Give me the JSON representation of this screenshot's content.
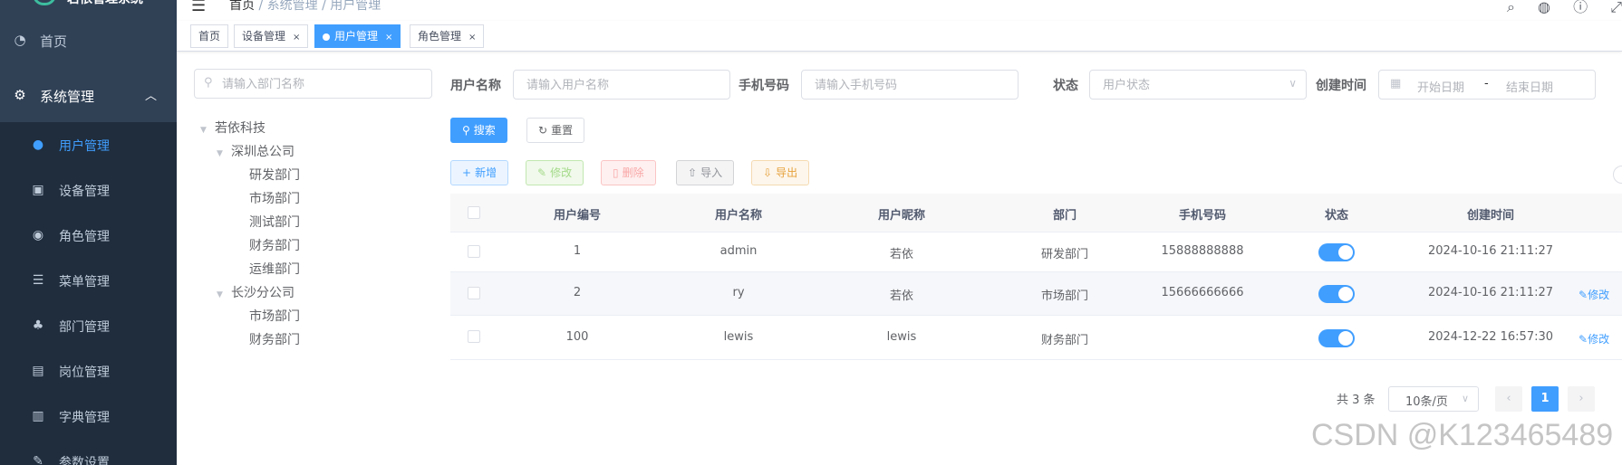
{
  "app": {
    "title": "若依管理系统"
  },
  "sidebar": {
    "items": [
      {
        "label": "首页",
        "icon": "dashboard-icon"
      },
      {
        "label": "系统管理",
        "icon": "gear-icon",
        "expanded": true
      }
    ],
    "sub_items": [
      {
        "label": "用户管理",
        "icon": "user-icon",
        "active": true
      },
      {
        "label": "设备管理",
        "icon": "device-icon"
      },
      {
        "label": "角色管理",
        "icon": "peoples-icon"
      },
      {
        "label": "菜单管理",
        "icon": "tree-table-icon"
      },
      {
        "label": "部门管理",
        "icon": "tree-icon"
      },
      {
        "label": "岗位管理",
        "icon": "post-icon"
      },
      {
        "label": "字典管理",
        "icon": "dict-icon"
      },
      {
        "label": "参数设置",
        "icon": "edit-icon"
      }
    ]
  },
  "navbar": {
    "breadcrumb": [
      "首页",
      "系统管理",
      "用户管理"
    ]
  },
  "tags": [
    {
      "label": "首页",
      "closable": false,
      "active": false
    },
    {
      "label": "设备管理",
      "closable": true,
      "active": false
    },
    {
      "label": "用户管理",
      "closable": true,
      "active": true
    },
    {
      "label": "角色管理",
      "closable": true,
      "active": false
    }
  ],
  "dept_tree": {
    "search_placeholder": "请输入部门名称",
    "nodes": [
      {
        "label": "若依科技",
        "level": 0,
        "expanded": true
      },
      {
        "label": "深圳总公司",
        "level": 1,
        "expanded": true
      },
      {
        "label": "研发部门",
        "level": 2
      },
      {
        "label": "市场部门",
        "level": 2
      },
      {
        "label": "测试部门",
        "level": 2
      },
      {
        "label": "财务部门",
        "level": 2
      },
      {
        "label": "运维部门",
        "level": 2
      },
      {
        "label": "长沙分公司",
        "level": 1,
        "expanded": true
      },
      {
        "label": "市场部门",
        "level": 2
      },
      {
        "label": "财务部门",
        "level": 2
      }
    ]
  },
  "search": {
    "username_label": "用户名称",
    "username_placeholder": "请输入用户名称",
    "phone_label": "手机号码",
    "phone_placeholder": "请输入手机号码",
    "status_label": "状态",
    "status_placeholder": "用户状态",
    "created_label": "创建时间",
    "start_placeholder": "开始日期",
    "range_separator": "-",
    "end_placeholder": "结束日期",
    "search_button": "搜索",
    "reset_button": "重置"
  },
  "toolbar": {
    "add": "新增",
    "edit": "修改",
    "delete": "删除",
    "import": "导入",
    "export": "导出"
  },
  "table": {
    "columns": [
      "用户编号",
      "用户名称",
      "用户昵称",
      "部门",
      "手机号码",
      "状态",
      "创建时间"
    ],
    "rows": [
      {
        "id": "1",
        "username": "admin",
        "nickname": "若依",
        "dept": "研发部门",
        "phone": "15888888888",
        "status_on": true,
        "created": "2024-10-16 21:11:27",
        "action": ""
      },
      {
        "id": "2",
        "username": "ry",
        "nickname": "若依",
        "dept": "市场部门",
        "phone": "15666666666",
        "status_on": true,
        "created": "2024-10-16 21:11:27",
        "action": "修改"
      },
      {
        "id": "100",
        "username": "lewis",
        "nickname": "lewis",
        "dept": "财务部门",
        "phone": "",
        "status_on": true,
        "created": "2024-12-22 16:57:30",
        "action": "修改"
      }
    ]
  },
  "pagination": {
    "total_text": "共 3 条",
    "page_size": "10条/页",
    "current_page": "1"
  },
  "watermark": "CSDN @K123465489",
  "colors": {
    "primary": "#409eff",
    "sidebar_bg": "#304156",
    "submenu_bg": "#1f2d3d"
  }
}
